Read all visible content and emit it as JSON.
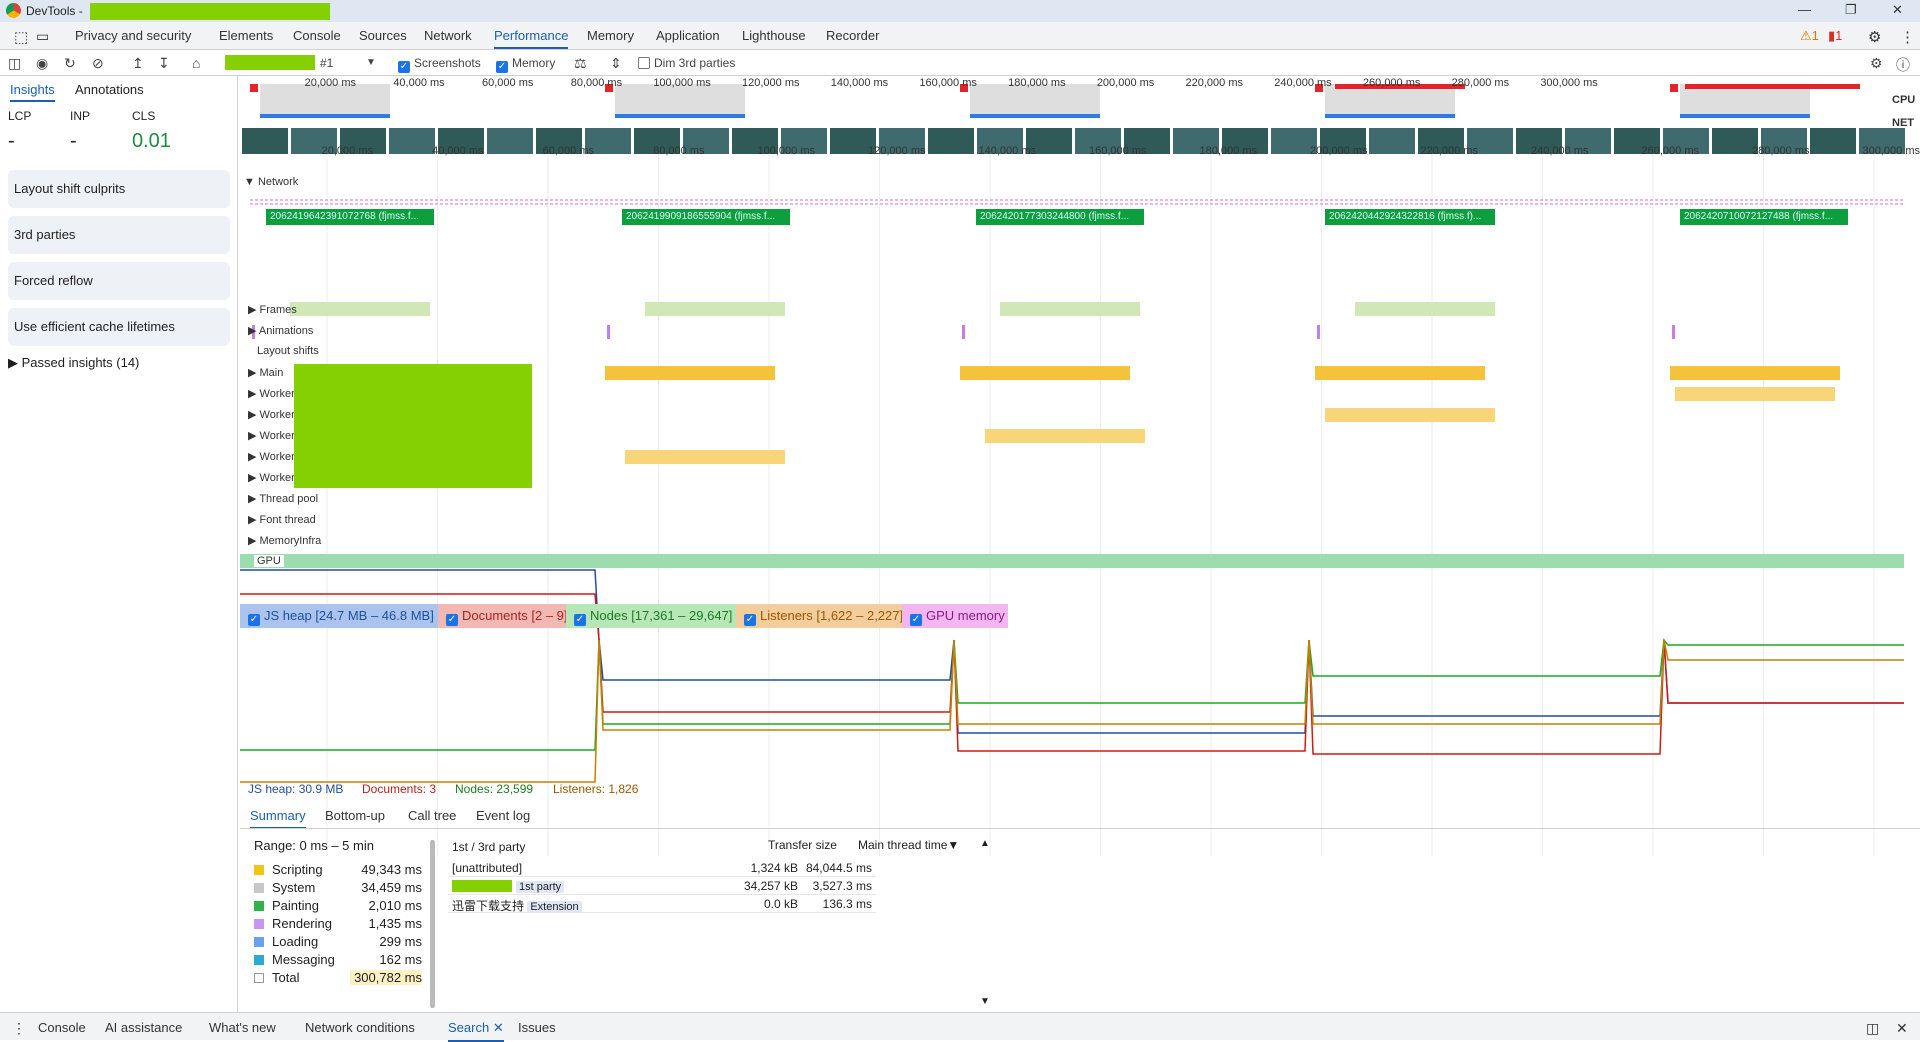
{
  "window": {
    "title": "DevTools -"
  },
  "tabs": [
    "Privacy and security",
    "Elements",
    "Console",
    "Sources",
    "Network",
    "Performance",
    "Memory",
    "Application",
    "Lighthouse",
    "Recorder"
  ],
  "badges": {
    "warnings": "1",
    "errors": "1"
  },
  "toolbar": {
    "recording": "#1",
    "screenshots": "Screenshots",
    "memory": "Memory",
    "dim": "Dim 3rd parties"
  },
  "sidebar": {
    "tabs": [
      "Insights",
      "Annotations"
    ],
    "metrics": [
      {
        "label": "LCP",
        "value": "-"
      },
      {
        "label": "INP",
        "value": "-"
      },
      {
        "label": "CLS",
        "value": "0.01"
      }
    ],
    "cards": [
      "Layout shift culprits",
      "3rd parties",
      "Forced reflow",
      "Use efficient cache lifetimes"
    ],
    "passed": "Passed insights (14)"
  },
  "overview_ticks": [
    "20,000 ms",
    "40,000 ms",
    "60,000 ms",
    "80,000 ms",
    "100,000 ms",
    "120,000 ms",
    "140,000 ms",
    "160,000 ms",
    "180,000 ms",
    "200,000 ms",
    "220,000 ms",
    "240,000 ms",
    "260,000 ms",
    "280,000 ms",
    "300,000 ms"
  ],
  "overview_labels": {
    "cpu": "CPU",
    "net": "NET"
  },
  "network": {
    "label": "Network",
    "requests": [
      "2062419642391072768 (fjmss.f...",
      "2062419909186555904 (fjmss.f...",
      "2062420177303244800 (fjmss.f...",
      "2062420442924322816 (fjmss.f)...",
      "2062420710072127488 (fjmss.f..."
    ]
  },
  "tracks": [
    "Frames",
    "Animations",
    "Layout shifts",
    "Main",
    "Worker",
    "Worker",
    "Worker",
    "Worker",
    "Worker",
    "Thread pool",
    "Font thread",
    "MemoryInfra",
    "GPU"
  ],
  "memory_legend": [
    {
      "label": "JS heap [24.7 MB – 46.8 MB]",
      "bg": "#aac4ee",
      "fg": "#1f4fa0"
    },
    {
      "label": "Documents [2 – 9]",
      "bg": "#f2b8b4",
      "fg": "#b0231c"
    },
    {
      "label": "Nodes [17,361 – 29,647]",
      "bg": "#b7e6b7",
      "fg": "#1e7d22"
    },
    {
      "label": "Listeners [1,622 – 2,227]",
      "bg": "#f3cd9c",
      "fg": "#9a5800"
    },
    {
      "label": "GPU memory",
      "bg": "#f2b7f0",
      "fg": "#8d1a8a"
    }
  ],
  "memory_readout": {
    "js": "JS heap: 30.9 MB",
    "docs": "Documents: 3",
    "nodes": "Nodes: 23,599",
    "listeners": "Listeners: 1,826"
  },
  "bottom": {
    "tabs": [
      "Summary",
      "Bottom-up",
      "Call tree",
      "Event log"
    ],
    "range": "Range: 0 ms – 5 min",
    "summary": [
      {
        "label": "Scripting",
        "value": "49,343 ms",
        "color": "#f3c416"
      },
      {
        "label": "System",
        "value": "34,459 ms",
        "color": "#c8c8c8"
      },
      {
        "label": "Painting",
        "value": "2,010 ms",
        "color": "#2fb34a"
      },
      {
        "label": "Rendering",
        "value": "1,435 ms",
        "color": "#c896f0"
      },
      {
        "label": "Loading",
        "value": "299 ms",
        "color": "#6b9ff0"
      },
      {
        "label": "Messaging",
        "value": "162 ms",
        "color": "#2ea9cf"
      },
      {
        "label": "Total",
        "value": "300,782 ms",
        "color": "#ffffff"
      }
    ],
    "table": {
      "headers": [
        "1st / 3rd party",
        "Transfer size",
        "Main thread time"
      ],
      "rows": [
        {
          "name": "[unattributed]",
          "tag": "",
          "size": "1,324 kB",
          "time": "84,044.5 ms"
        },
        {
          "name": "",
          "tag": "1st party",
          "size": "34,257 kB",
          "time": "3,527.3 ms"
        },
        {
          "name": "迅雷下载支持",
          "tag": "Extension",
          "size": "0.0 kB",
          "time": "136.3 ms"
        }
      ]
    }
  },
  "drawer": [
    "Console",
    "AI assistance",
    "What's new",
    "Network conditions",
    "Search",
    "Issues"
  ]
}
